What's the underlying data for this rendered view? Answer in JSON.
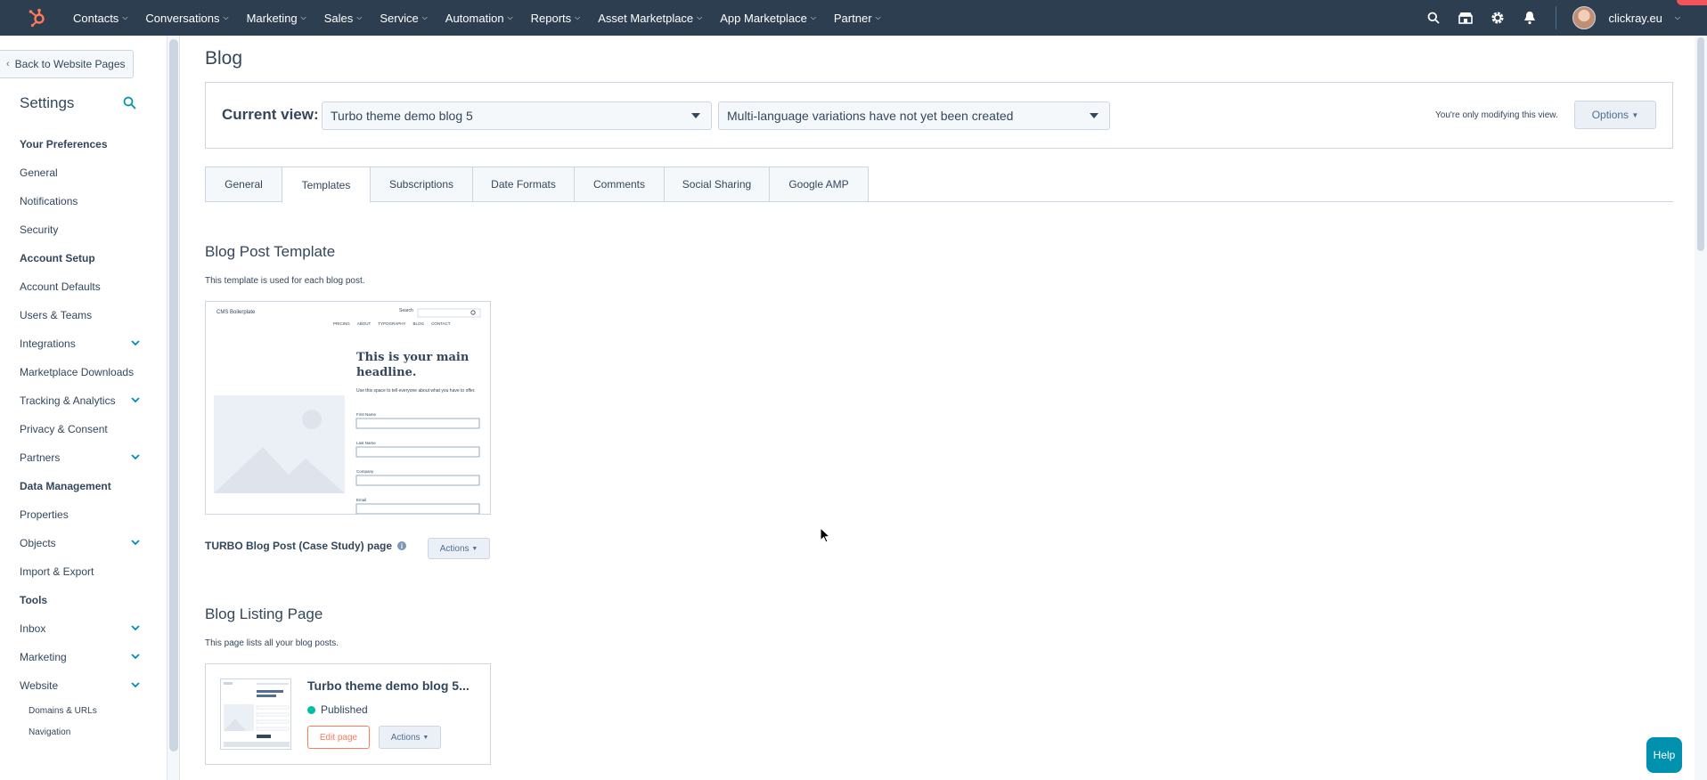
{
  "topnav": {
    "items": [
      "Contacts",
      "Conversations",
      "Marketing",
      "Sales",
      "Service",
      "Automation",
      "Reports",
      "Asset Marketplace",
      "App Marketplace",
      "Partner"
    ],
    "account": "clickray.eu"
  },
  "sidebar": {
    "back_label": "Back to Website Pages",
    "title": "Settings",
    "sections": [
      {
        "title": "Your Preferences",
        "items": [
          {
            "label": "General",
            "expandable": false
          },
          {
            "label": "Notifications",
            "expandable": false
          },
          {
            "label": "Security",
            "expandable": false
          }
        ]
      },
      {
        "title": "Account Setup",
        "items": [
          {
            "label": "Account Defaults",
            "expandable": false
          },
          {
            "label": "Users & Teams",
            "expandable": false
          },
          {
            "label": "Integrations",
            "expandable": true
          },
          {
            "label": "Marketplace Downloads",
            "expandable": false
          },
          {
            "label": "Tracking & Analytics",
            "expandable": true
          },
          {
            "label": "Privacy & Consent",
            "expandable": false
          },
          {
            "label": "Partners",
            "expandable": true
          }
        ]
      },
      {
        "title": "Data Management",
        "items": [
          {
            "label": "Properties",
            "expandable": false
          },
          {
            "label": "Objects",
            "expandable": true
          },
          {
            "label": "Import & Export",
            "expandable": false
          }
        ]
      },
      {
        "title": "Tools",
        "items": [
          {
            "label": "Inbox",
            "expandable": true
          },
          {
            "label": "Marketing",
            "expandable": true
          },
          {
            "label": "Website",
            "expandable": true
          }
        ]
      }
    ],
    "sub_items": [
      "Domains & URLs",
      "Navigation"
    ]
  },
  "main": {
    "title": "Blog",
    "current_view_label": "Current view:",
    "blog_select": "Turbo theme demo blog 5",
    "language_select": "Multi-language variations have not yet been created",
    "only_modifying": "You're only modifying this view.",
    "options_label": "Options",
    "tabs": [
      "General",
      "Templates",
      "Subscriptions",
      "Date Formats",
      "Comments",
      "Social Sharing",
      "Google AMP"
    ],
    "active_tab": "Templates",
    "post_template": {
      "heading": "Blog Post Template",
      "description": "This template is used for each blog post.",
      "name": "TURBO Blog Post (Case Study) page",
      "actions_label": "Actions",
      "preview": {
        "brand": "CMS Boilerplate",
        "search_label": "Search",
        "nav": [
          "PRICING",
          "ABOUT",
          "TYPOGRAPHY",
          "BLOG",
          "CONTACT"
        ],
        "headline": "This is your main headline.",
        "subtext": "Use this space to tell everyone about what you have to offer.",
        "fields": [
          "First Name",
          "Last Name",
          "Company",
          "Email"
        ]
      }
    },
    "listing": {
      "heading": "Blog Listing Page",
      "description": "This page lists all your blog posts.",
      "card_title": "Turbo theme demo blog 5...",
      "status": "Published",
      "edit_label": "Edit page",
      "actions_label": "Actions"
    },
    "help_label": "Help"
  },
  "colors": {
    "nav_bg": "#2d3e50",
    "accent": "#ff7a59",
    "teal": "#00bda5",
    "link": "#0091ae"
  }
}
